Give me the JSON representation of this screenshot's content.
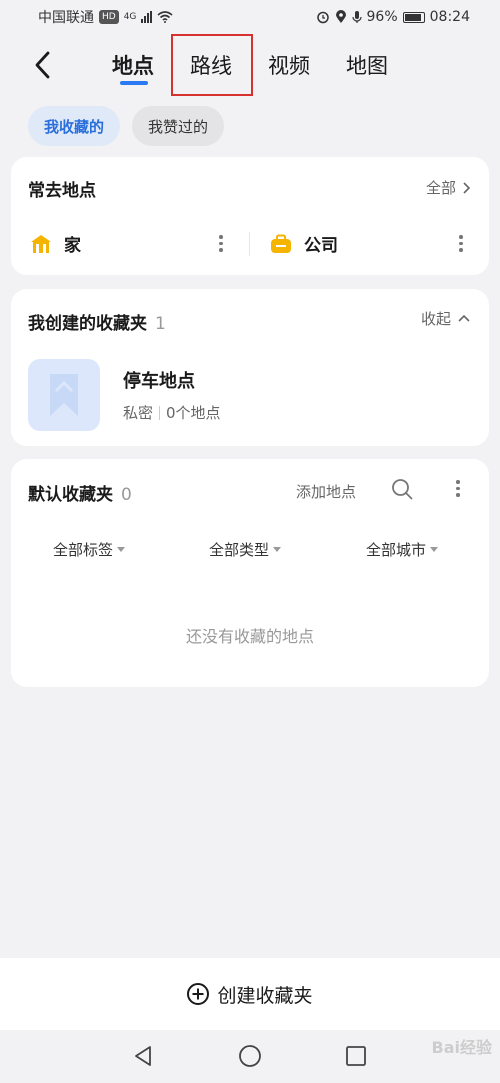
{
  "status_bar": {
    "carrier": "中国联通",
    "hd": "HD",
    "network": "4G",
    "battery": "96%",
    "time": "08:24"
  },
  "nav": {
    "tabs": [
      {
        "label": "地点",
        "active": true
      },
      {
        "label": "路线",
        "active": false
      },
      {
        "label": "视频",
        "active": false
      },
      {
        "label": "地图",
        "active": false
      }
    ]
  },
  "chips": [
    {
      "label": "我收藏的",
      "active": true
    },
    {
      "label": "我赞过的",
      "active": false
    }
  ],
  "frequent": {
    "title": "常去地点",
    "action": "全部",
    "home": "家",
    "work": "公司"
  },
  "created_folders": {
    "title": "我创建的收藏夹",
    "count": "1",
    "action": "收起",
    "folder": {
      "name": "停车地点",
      "privacy": "私密",
      "count_text": "0个地点"
    }
  },
  "default_folder": {
    "title": "默认收藏夹",
    "count": "0",
    "add_label": "添加地点",
    "filters": [
      "全部标签",
      "全部类型",
      "全部城市"
    ],
    "empty_text": "还没有收藏的地点"
  },
  "bottom": {
    "create_label": "创建收藏夹"
  },
  "watermark": "Bai经验",
  "colors": {
    "accent": "#2a7af3",
    "highlight_box": "#d6312f",
    "home_icon": "#f4b400",
    "work_icon": "#f4b400"
  }
}
